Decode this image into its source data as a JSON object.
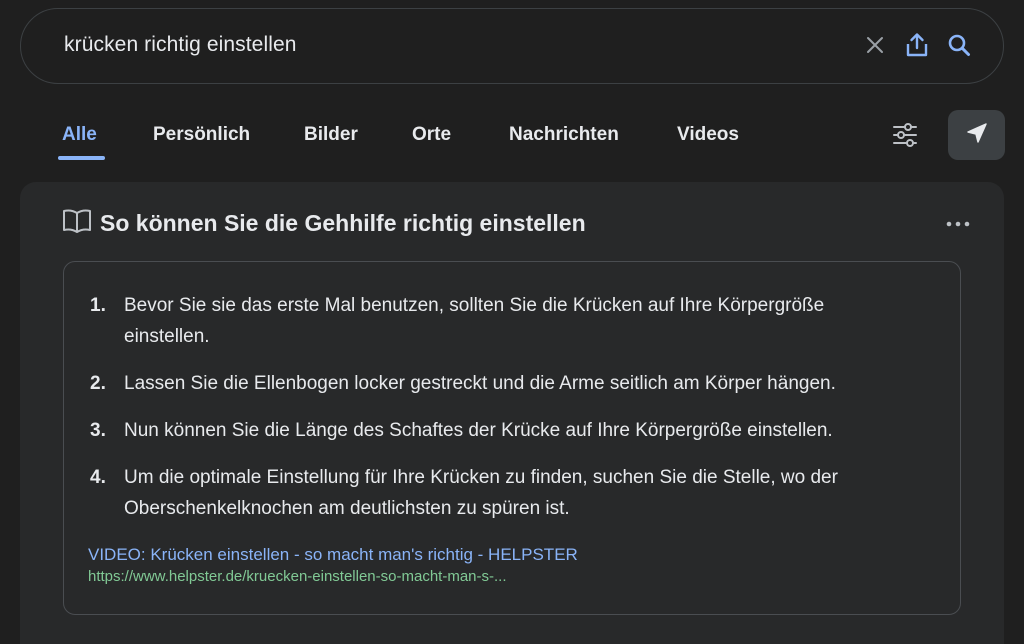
{
  "search": {
    "query": "krücken richtig einstellen",
    "icons": [
      "close-icon",
      "share-icon",
      "search-icon"
    ]
  },
  "tabs": [
    {
      "label": "Alle",
      "active": true
    },
    {
      "label": "Persönlich",
      "active": false
    },
    {
      "label": "Bilder",
      "active": false
    },
    {
      "label": "Orte",
      "active": false
    },
    {
      "label": "Nachrichten",
      "active": false
    },
    {
      "label": "Videos",
      "active": false
    }
  ],
  "toolbar": {
    "filter_icon": "tune-icon",
    "nav_icon": "navigation-arrow-icon"
  },
  "featured_snippet": {
    "icon": "book-icon",
    "title": "So können Sie die Gehhilfe richtig einstellen",
    "more_icon": "more-horizontal-icon",
    "steps": [
      {
        "number": "1.",
        "text": "Bevor Sie sie das erste Mal benutzen, sollten Sie die Krücken auf Ihre Körpergröße einstellen."
      },
      {
        "number": "2.",
        "text": "Lassen Sie die Ellenbogen locker gestreckt und die Arme seitlich am Körper hängen."
      },
      {
        "number": "3.",
        "text": "Nun können Sie die Länge des Schaftes der Krücke auf Ihre Körpergröße einstellen."
      },
      {
        "number": "4.",
        "text": "Um die optimale Einstellung für Ihre Krücken zu finden, suchen Sie die Stelle, wo der Oberschenkelknochen am deutlichsten zu spüren ist."
      }
    ],
    "source_title": "VIDEO: Krücken einstellen - so macht man's richtig - HELPSTER",
    "source_url": "https://www.helpster.de/kruecken-einstellen-so-macht-man-s-..."
  },
  "colors": {
    "background": "#1f1f1f",
    "card": "#28292a",
    "accent_blue": "#8ab4f8",
    "url_green": "#81c995",
    "text": "#e8eaed"
  }
}
